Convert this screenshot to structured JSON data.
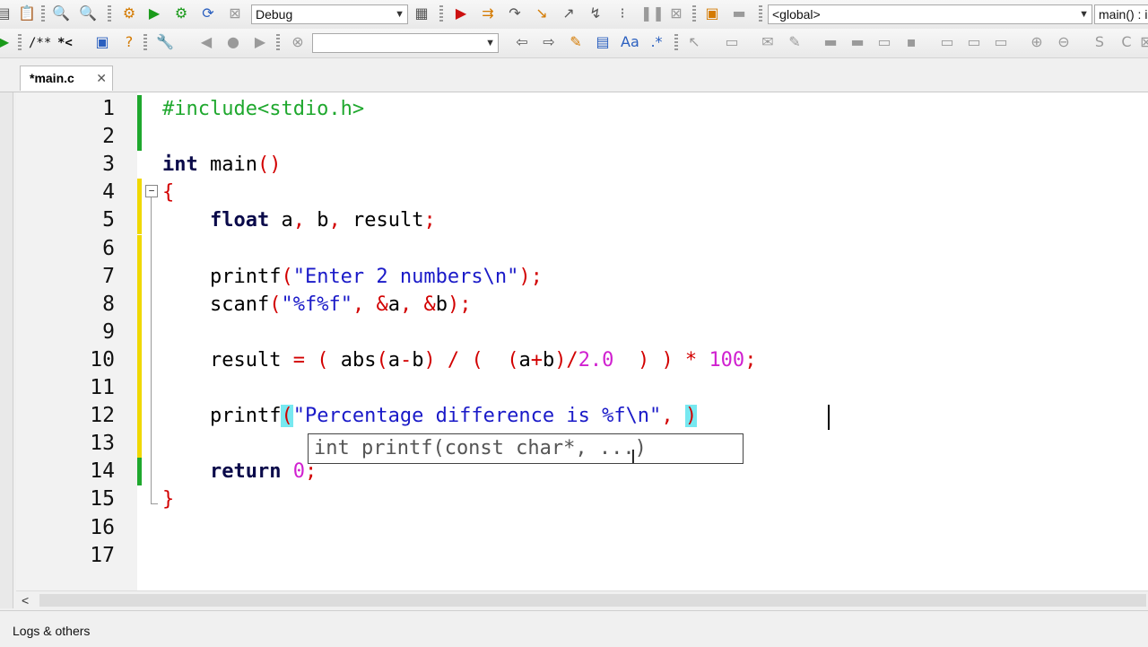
{
  "toolbar1": {
    "build_target": "Debug",
    "scope": "<global>",
    "function": "main() : i"
  },
  "toolbar2": {
    "comment_block_label": "/**",
    "comment_line_label": "*<",
    "search_value": ""
  },
  "tab": {
    "label": "*main.c",
    "close": "✕"
  },
  "editor": {
    "line_numbers": [
      "1",
      "2",
      "3",
      "4",
      "5",
      "6",
      "7",
      "8",
      "9",
      "10",
      "11",
      "12",
      "13",
      "14",
      "15",
      "16",
      "17"
    ],
    "lines": [
      [
        {
          "t": "#include<stdio.h>",
          "c": "pp"
        }
      ],
      [],
      [
        {
          "t": "int",
          "c": "kw"
        },
        {
          "t": " main",
          "c": ""
        },
        {
          "t": "()",
          "c": "pun"
        }
      ],
      [
        {
          "t": "{",
          "c": "pun"
        }
      ],
      [
        {
          "t": "    ",
          "c": ""
        },
        {
          "t": "float",
          "c": "kw"
        },
        {
          "t": " a",
          "c": ""
        },
        {
          "t": ",",
          "c": "pun"
        },
        {
          "t": " b",
          "c": ""
        },
        {
          "t": ",",
          "c": "pun"
        },
        {
          "t": " result",
          "c": ""
        },
        {
          "t": ";",
          "c": "pun"
        }
      ],
      [],
      [
        {
          "t": "    printf",
          "c": ""
        },
        {
          "t": "(",
          "c": "pun"
        },
        {
          "t": "\"Enter 2 numbers\\n\"",
          "c": "str"
        },
        {
          "t": ");",
          "c": "pun"
        }
      ],
      [
        {
          "t": "    scanf",
          "c": ""
        },
        {
          "t": "(",
          "c": "pun"
        },
        {
          "t": "\"%f%f\"",
          "c": "str"
        },
        {
          "t": ", &",
          "c": "pun"
        },
        {
          "t": "a",
          "c": ""
        },
        {
          "t": ", &",
          "c": "pun"
        },
        {
          "t": "b",
          "c": ""
        },
        {
          "t": ");",
          "c": "pun"
        }
      ],
      [],
      [
        {
          "t": "    result ",
          "c": ""
        },
        {
          "t": "=",
          "c": "pun"
        },
        {
          "t": " ",
          "c": ""
        },
        {
          "t": "(",
          "c": "pun"
        },
        {
          "t": " abs",
          "c": ""
        },
        {
          "t": "(",
          "c": "pun"
        },
        {
          "t": "a",
          "c": ""
        },
        {
          "t": "-",
          "c": "pun"
        },
        {
          "t": "b",
          "c": ""
        },
        {
          "t": ")",
          "c": "pun"
        },
        {
          "t": " / ",
          "c": "pun"
        },
        {
          "t": "(",
          "c": "pun"
        },
        {
          "t": "  ",
          "c": ""
        },
        {
          "t": "(",
          "c": "pun"
        },
        {
          "t": "a",
          "c": ""
        },
        {
          "t": "+",
          "c": "pun"
        },
        {
          "t": "b",
          "c": ""
        },
        {
          "t": ")/",
          "c": "pun"
        },
        {
          "t": "2.0",
          "c": "num"
        },
        {
          "t": "  ",
          "c": ""
        },
        {
          "t": ")",
          "c": "pun"
        },
        {
          "t": " ",
          "c": ""
        },
        {
          "t": ")",
          "c": "pun"
        },
        {
          "t": " * ",
          "c": "pun"
        },
        {
          "t": "100",
          "c": "num"
        },
        {
          "t": ";",
          "c": "pun"
        }
      ],
      [],
      [
        {
          "t": "    printf",
          "c": ""
        },
        {
          "t": "(",
          "c": "pun hl"
        },
        {
          "t": "\"Percentage difference is %f\\n\"",
          "c": "str"
        },
        {
          "t": ", ",
          "c": "pun"
        },
        {
          "t": ")",
          "c": "pun hl"
        }
      ],
      [],
      [
        {
          "t": "    ",
          "c": ""
        },
        {
          "t": "return",
          "c": "kw"
        },
        {
          "t": " ",
          "c": ""
        },
        {
          "t": "0",
          "c": "pink"
        },
        {
          "t": ";",
          "c": "pun"
        }
      ],
      [
        {
          "t": "}",
          "c": "pun"
        }
      ],
      [],
      []
    ],
    "change_markers": [
      "green",
      "green",
      "",
      "yellow",
      "yellow",
      "yellow",
      "yellow",
      "yellow",
      "yellow",
      "yellow",
      "yellow",
      "yellow",
      "yellow",
      "green",
      "",
      "",
      ""
    ],
    "calltip": "int printf(const char*, ...)"
  },
  "bottom": {
    "logs_tab": "Logs & others"
  },
  "colors": {
    "accent_green": "#1fa82e",
    "modified_yellow": "#f0d800",
    "brace_highlight": "#77e8f0"
  }
}
